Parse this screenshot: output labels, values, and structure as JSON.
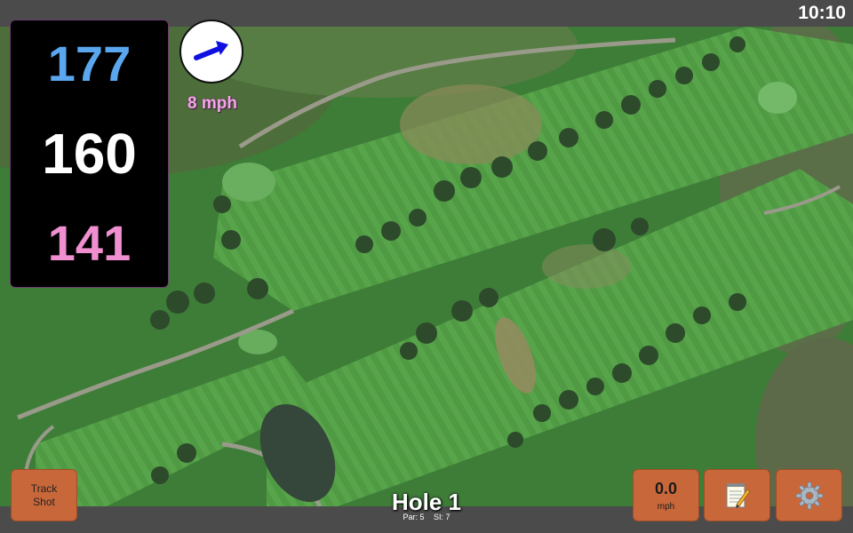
{
  "status_bar": {
    "time": "10:10"
  },
  "distances": {
    "back": "177",
    "middle": "160",
    "front": "141"
  },
  "wind": {
    "speed_label": "8 mph",
    "direction": "east-northeast",
    "arrow_color": "#1010e0"
  },
  "buttons": {
    "track_shot_line1": "Track",
    "track_shot_line2": "Shot",
    "speed_value": "0.0",
    "speed_unit": "mph",
    "notes_icon": "notepad-pencil-icon",
    "settings_icon": "gear-icon"
  },
  "hole": {
    "title": "Hole 1",
    "par": "Par: 5",
    "si": "SI: 7"
  },
  "colors": {
    "back_distance": "#5aa7ef",
    "mid_distance": "#ffffff",
    "front_distance": "#f08fd0",
    "button": "#c8683a",
    "wind_text": "#f2a6e6"
  }
}
